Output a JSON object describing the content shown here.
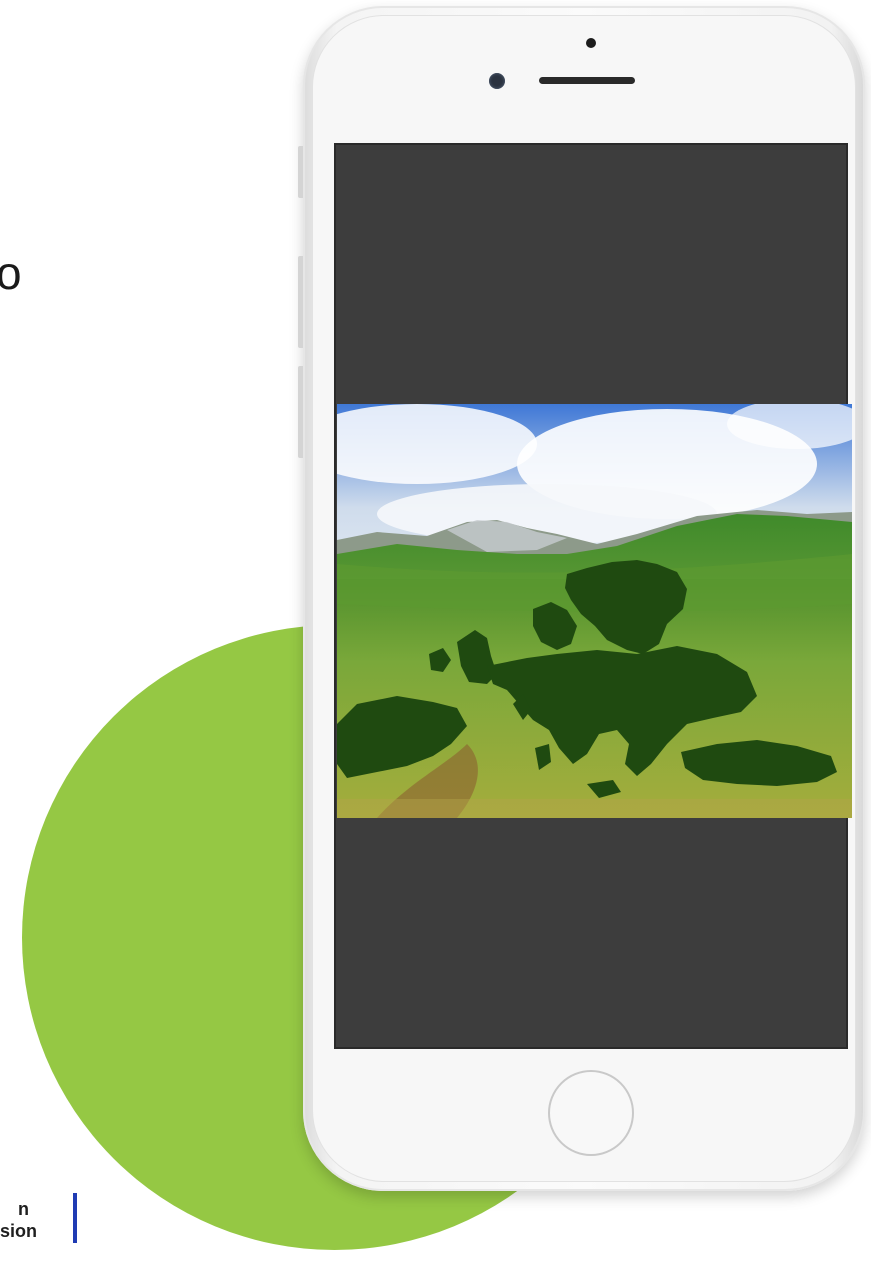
{
  "partial_heading_text": "o",
  "logo": {
    "line1": "n",
    "line2": "sion",
    "bar_color": "#1f3bb3"
  },
  "colors": {
    "accent_circle": "#95c844",
    "screen_bg": "#3d3d3d",
    "sky": "#5a8fd8",
    "grass": "#8ab23a",
    "europe_map": "#1f4a10"
  },
  "icons": {
    "front_camera": "camera-icon",
    "home_button": "home-button-icon"
  }
}
